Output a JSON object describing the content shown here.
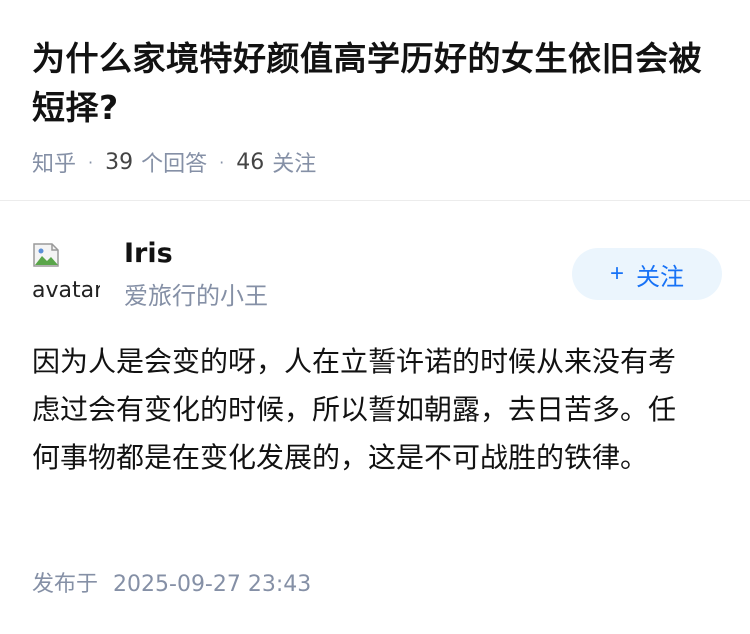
{
  "question": {
    "title": "为什么家境特好颜值高学历好的女生依旧会被短择?",
    "source": "知乎",
    "answer_count": "39",
    "answer_label": "个回答",
    "follower_count": "46",
    "follower_label": "关注"
  },
  "author": {
    "avatar_alt": "avatar",
    "name": "Iris",
    "bio": "爱旅行的小王",
    "follow_label": "关注",
    "follow_icon": "plus-icon"
  },
  "answer": {
    "content": "因为人是会变的呀，人在立誓许诺的时候从来没有考虑过会有变化的时候，所以誓如朝露，去日苦多。任何事物都是在变化发展的，这是不可战胜的铁律。",
    "published_label": "发布于",
    "published_time": "2025-09-27 23:43"
  },
  "colors": {
    "meta_gray": "#8590a6",
    "brand_blue": "#1772f6",
    "button_bg": "#ebf5fd"
  }
}
